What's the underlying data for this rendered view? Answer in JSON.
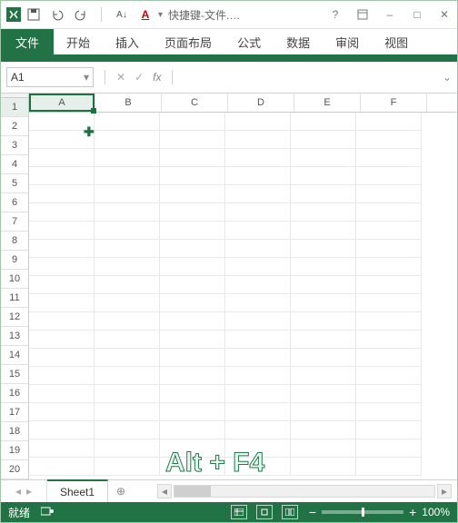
{
  "titlebar": {
    "doc_title": "快捷键-文件.xl...",
    "icons": {
      "excel": "excel-app",
      "save": "save",
      "undo": "undo",
      "redo": "redo",
      "sort": "sort-az",
      "font_color": "font-color"
    }
  },
  "win": {
    "help": "?",
    "min": "–",
    "max": "□",
    "close": "✕"
  },
  "ribbon": {
    "file": "文件",
    "tabs": [
      "开始",
      "插入",
      "页面布局",
      "公式",
      "数据",
      "审阅",
      "视图"
    ]
  },
  "fxbar": {
    "cell_ref": "A1",
    "fx": "fx"
  },
  "grid": {
    "cols": [
      "A",
      "B",
      "C",
      "D",
      "E",
      "F"
    ],
    "rows": [
      "1",
      "2",
      "3",
      "4",
      "5",
      "6",
      "7",
      "8",
      "9",
      "10",
      "11",
      "12",
      "13",
      "14",
      "15",
      "16",
      "17",
      "18",
      "19",
      "20"
    ],
    "selected": "A1"
  },
  "overlay": "Alt + F4",
  "tabs": {
    "sheet": "Sheet1"
  },
  "status": {
    "ready": "就绪",
    "zoom": "100%"
  }
}
